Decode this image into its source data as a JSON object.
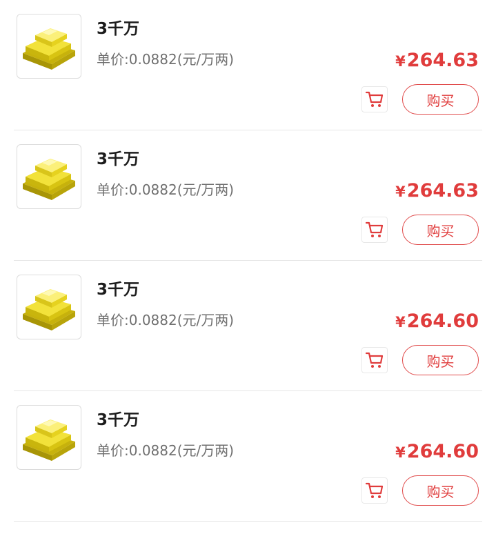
{
  "items": [
    {
      "title": "3千万",
      "unit_price": "单价:0.0882(元/万两)",
      "currency": "¥",
      "price": "264.63",
      "buy_label": "购买",
      "image_icon": "gold-bars-icon",
      "cart_icon": "shopping-cart-icon"
    },
    {
      "title": "3千万",
      "unit_price": "单价:0.0882(元/万两)",
      "currency": "¥",
      "price": "264.63",
      "buy_label": "购买",
      "image_icon": "gold-bars-icon",
      "cart_icon": "shopping-cart-icon"
    },
    {
      "title": "3千万",
      "unit_price": "单价:0.0882(元/万两)",
      "currency": "¥",
      "price": "264.60",
      "buy_label": "购买",
      "image_icon": "gold-bars-icon",
      "cart_icon": "shopping-cart-icon"
    },
    {
      "title": "3千万",
      "unit_price": "单价:0.0882(元/万两)",
      "currency": "¥",
      "price": "264.60",
      "buy_label": "购买",
      "image_icon": "gold-bars-icon",
      "cart_icon": "shopping-cart-icon"
    }
  ],
  "colors": {
    "accent": "#e03c3c",
    "title": "#1c1c1c",
    "secondary_text": "#6f6f6f",
    "divider": "#e6e6e6",
    "gold": "#e8d21a"
  }
}
